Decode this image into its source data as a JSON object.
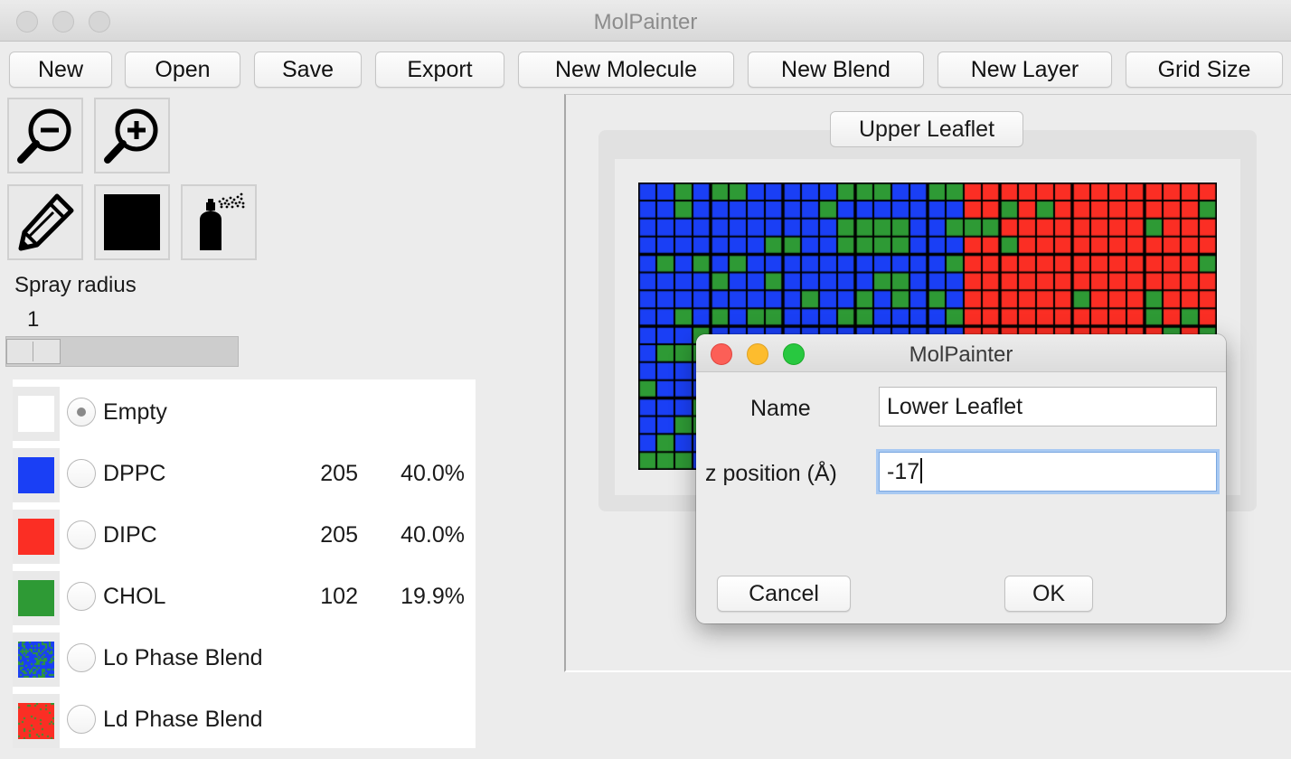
{
  "window": {
    "title": "MolPainter"
  },
  "toolbar": {
    "buttons": [
      "New",
      "Open",
      "Save",
      "Export",
      "New Molecule",
      "New Blend",
      "New Layer",
      "Grid Size"
    ]
  },
  "tools": {
    "zoom_out": "zoom-out-icon",
    "zoom_in": "zoom-in-icon",
    "pencil": "pencil-icon",
    "color": "#000000",
    "spray": "spray-can-icon"
  },
  "spray": {
    "label": "Spray radius",
    "value": "1",
    "level_fraction": 0.0
  },
  "legend": {
    "rows": [
      {
        "name": "Empty",
        "count": "",
        "percent": "",
        "color": "#ffffff",
        "selected": true
      },
      {
        "name": "DPPC",
        "count": "205",
        "percent": "40.0%",
        "color": "#1a3ff5",
        "selected": false
      },
      {
        "name": "DIPC",
        "count": "205",
        "percent": "40.0%",
        "color": "#fb2e24",
        "selected": false
      },
      {
        "name": "CHOL",
        "count": "102",
        "percent": "19.9%",
        "color": "#2e9a35",
        "selected": false
      },
      {
        "name": "Lo Phase Blend",
        "count": "",
        "percent": "",
        "color": "#1a3ff5",
        "selected": false
      },
      {
        "name": "Ld Phase Blend",
        "count": "",
        "percent": "",
        "color": "#fb2e24",
        "selected": false
      }
    ]
  },
  "canvas": {
    "layer_tab": "Upper Leaflet",
    "colors": {
      "blue": "#1a3ff5",
      "red": "#fb2e24",
      "green": "#2e9a35",
      "line": "#000000"
    }
  },
  "dialog": {
    "title": "MolPainter",
    "name_label": "Name",
    "name_value": "Lower Leaflet",
    "z_label": "z position (Å)",
    "z_value": "-17",
    "cancel": "Cancel",
    "ok": "OK"
  }
}
